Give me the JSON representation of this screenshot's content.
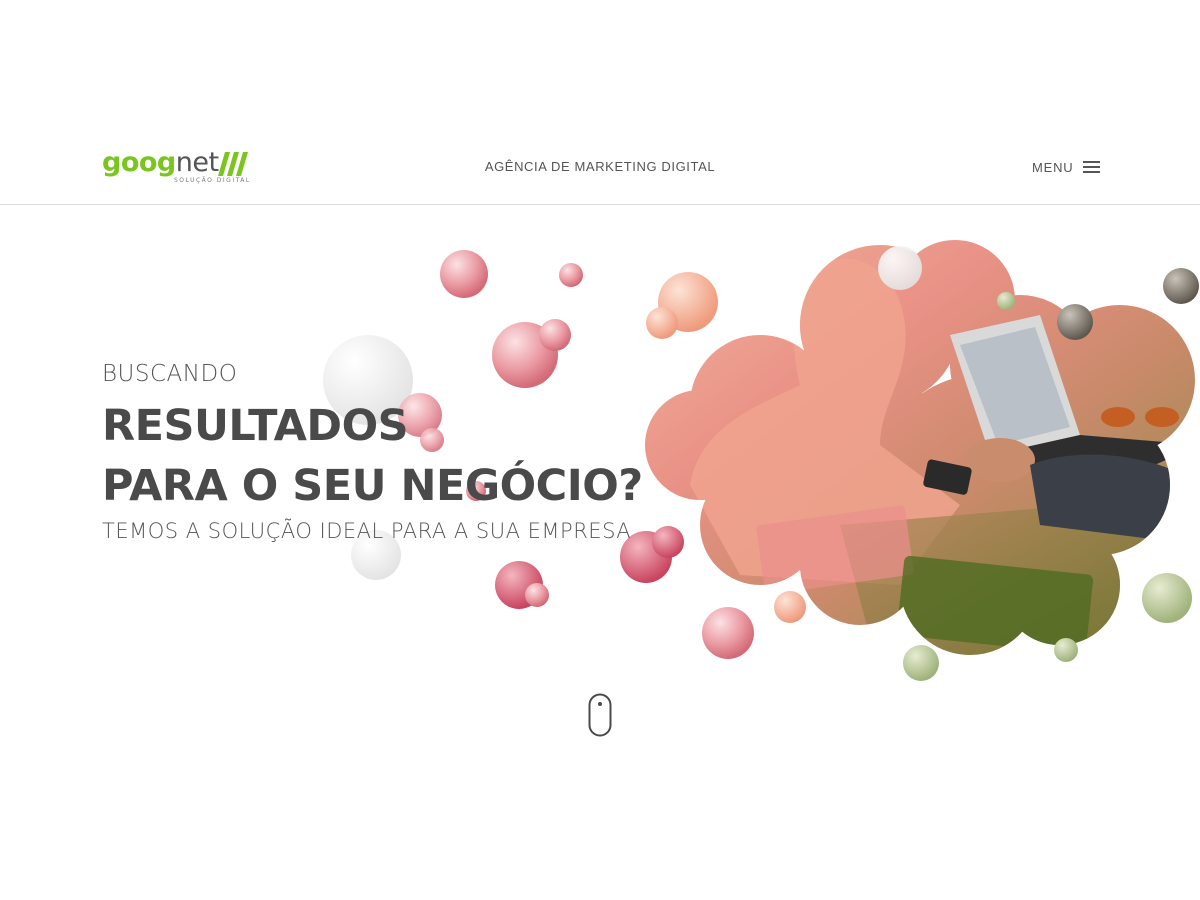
{
  "header": {
    "logo": {
      "part1": "goog",
      "part2": "net",
      "slashes": "///",
      "tagline": "SOLUÇÃO DIGITAL",
      "brand_green": "#7ac51e",
      "brand_gray": "#555555"
    },
    "title": "AGÊNCIA DE MARKETING DIGITAL",
    "menu_label": "MENU",
    "menu_icon": "hamburger-icon"
  },
  "hero": {
    "eyebrow": "BUSCANDO",
    "heading_line1": "RESULTADOS",
    "heading_line2": "PARA O SEU NEGÓCIO?",
    "subheading": "TEMOS A SOLUÇÃO IDEAL PARA A SUA EMPRESA",
    "image_description": "people working with laptop",
    "accent_pink": "#e07a86",
    "accent_peach": "#f2a98a"
  },
  "scroll_indicator": {
    "icon": "mouse-scroll-icon"
  }
}
